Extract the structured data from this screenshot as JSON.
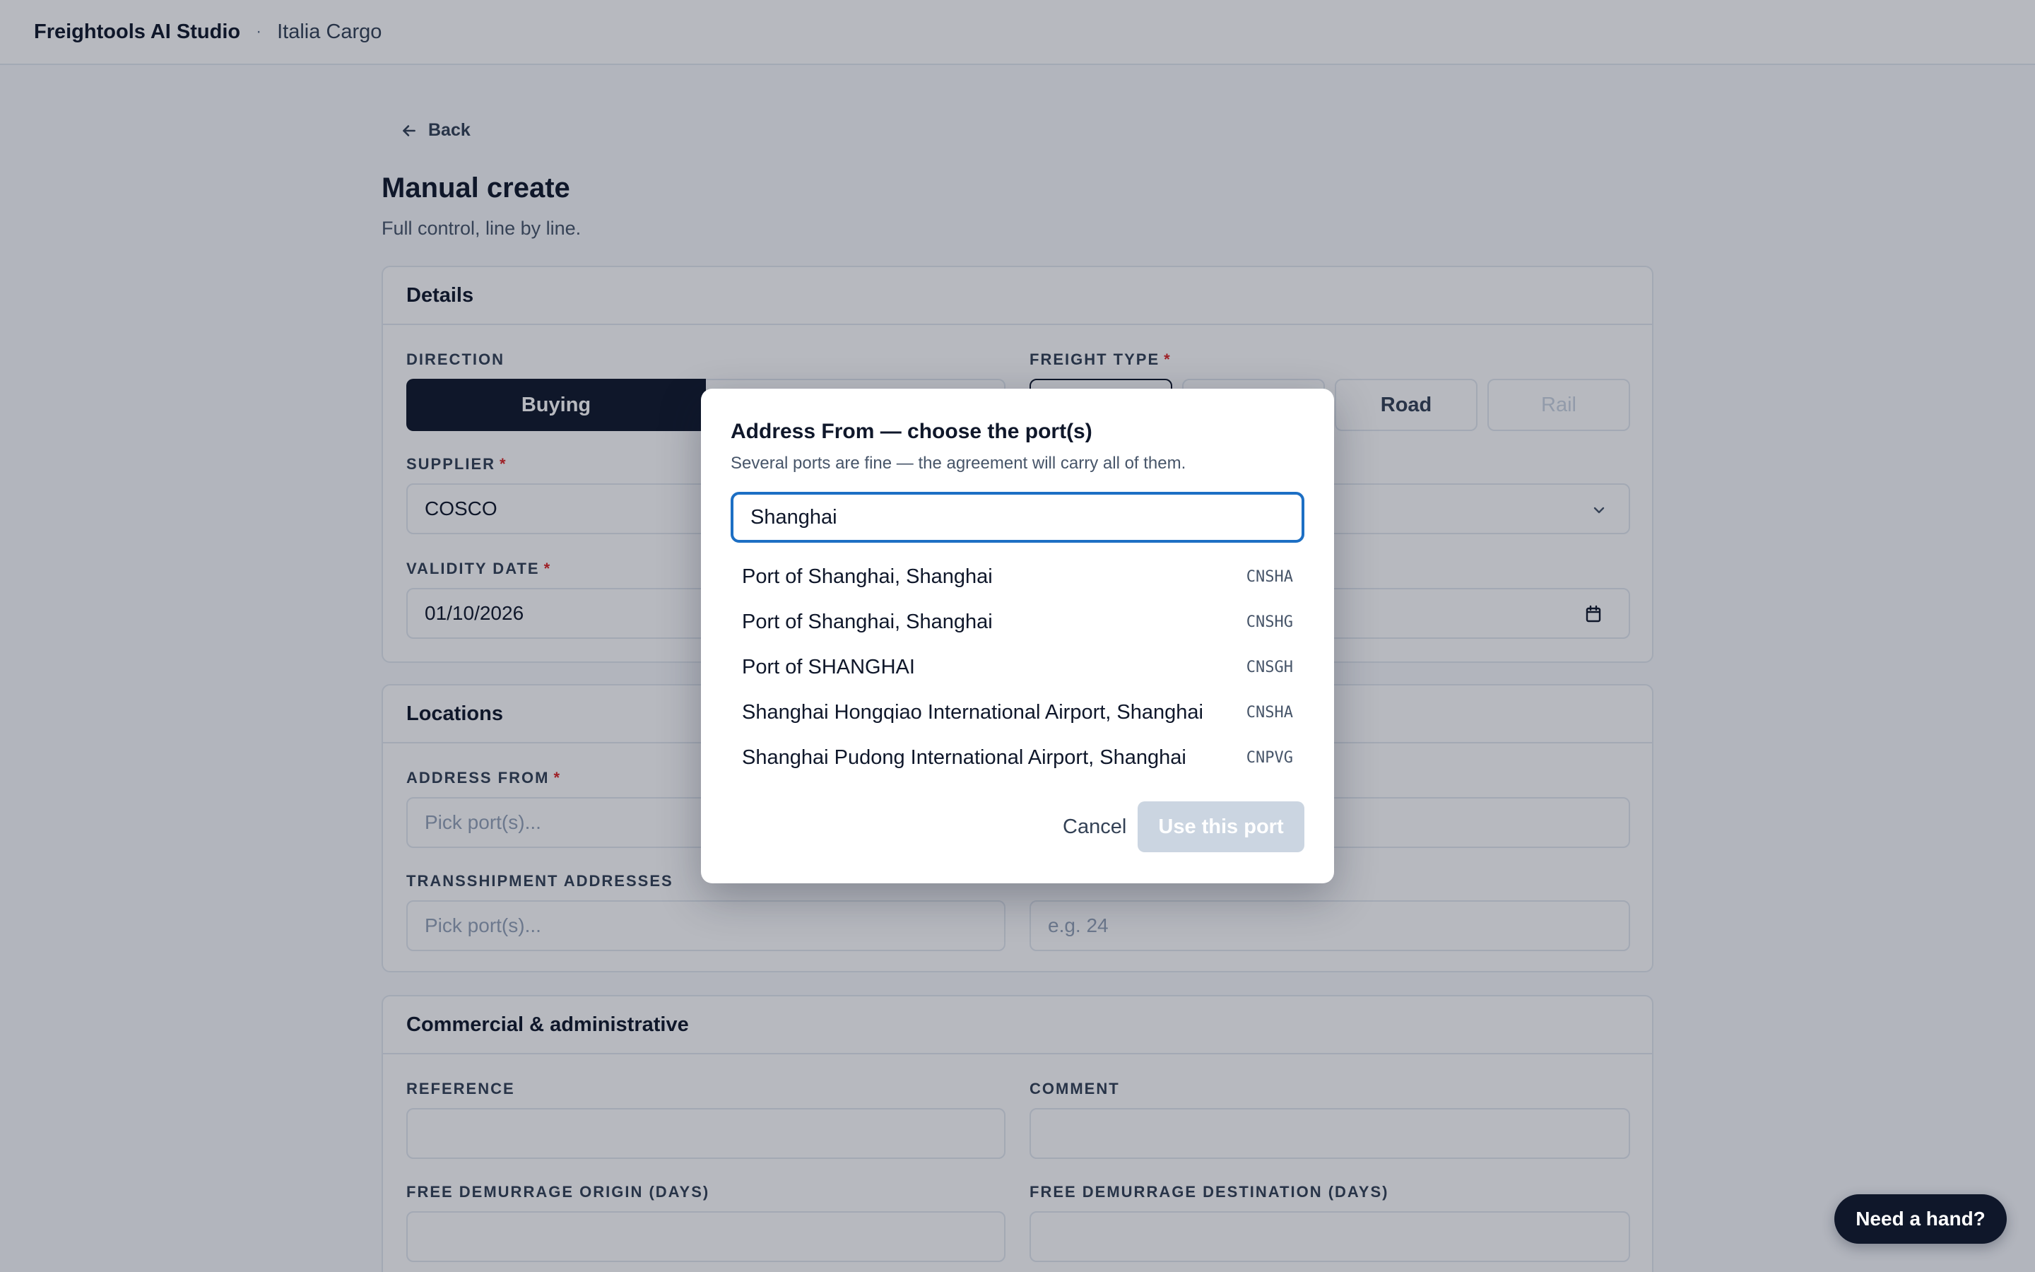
{
  "app": {
    "brand": "Freightools AI Studio",
    "separator": "·",
    "org": "Italia Cargo"
  },
  "nav": {
    "back_label": "Back"
  },
  "page": {
    "title": "Manual create",
    "subtitle": "Full control, line by line."
  },
  "details": {
    "heading": "Details",
    "direction_label": "DIRECTION",
    "direction_options": [
      "Buying"
    ],
    "direction_selected": "Buying",
    "freight_type_label": "FREIGHT TYPE",
    "freight_type_options": [
      "Road",
      "Rail"
    ],
    "supplier_label": "SUPPLIER",
    "supplier_value": "COSCO",
    "validity_label": "VALIDITY DATE",
    "validity_value": "01/10/2026"
  },
  "locations": {
    "heading": "Locations",
    "address_from_label": "ADDRESS FROM",
    "address_from_placeholder": "Pick port(s)...",
    "transshipment_label": "TRANSSHIPMENT ADDRESSES",
    "transshipment_placeholder": "Pick port(s)...",
    "transit_placeholder": "e.g. 24"
  },
  "commercial": {
    "heading": "Commercial & administrative",
    "reference_label": "REFERENCE",
    "comment_label": "COMMENT",
    "demurrage_origin_label": "FREE DEMURRAGE ORIGIN (DAYS)",
    "demurrage_destination_label": "FREE DEMURRAGE DESTINATION (DAYS)"
  },
  "modal": {
    "title": "Address From — choose the port(s)",
    "subtitle": "Several ports are fine — the agreement will carry all of them.",
    "search_value": "Shanghai",
    "options": [
      {
        "name": "Port of Shanghai, Shanghai",
        "code": "CNSHA"
      },
      {
        "name": "Port of Shanghai, Shanghai",
        "code": "CNSHG"
      },
      {
        "name": "Port of SHANGHAI",
        "code": "CNSGH"
      },
      {
        "name": "Shanghai Hongqiao International Airport, Shanghai",
        "code": "CNSHA"
      },
      {
        "name": "Shanghai Pudong International Airport, Shanghai",
        "code": "CNPVG"
      }
    ],
    "cancel_label": "Cancel",
    "confirm_label": "Use this port"
  },
  "help": {
    "label": "Need a hand?"
  },
  "colors": {
    "primary": "#0f172a",
    "focus": "#1d6fc4",
    "required": "#dc2626",
    "disabled": "#cbd5e1"
  }
}
